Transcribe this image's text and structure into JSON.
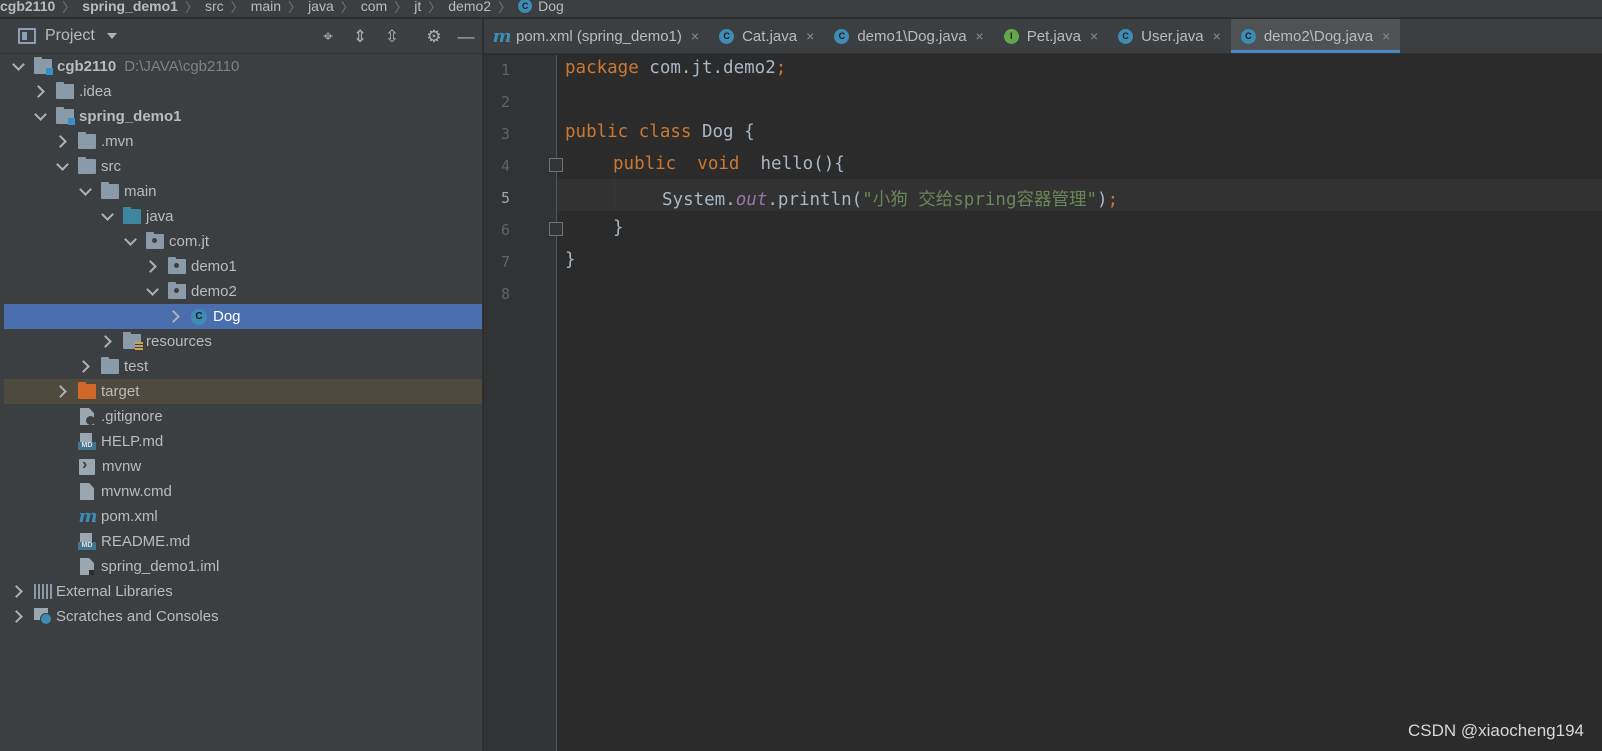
{
  "breadcrumb": {
    "items": [
      "cgb2110",
      "spring_demo1",
      "src",
      "main",
      "java",
      "com",
      "jt",
      "demo2"
    ],
    "last": "Dog",
    "last_icon": "C"
  },
  "project_panel": {
    "title": "Project",
    "icons": [
      "locate-icon",
      "expand-all-icon",
      "collapse-all-icon",
      "gear-icon",
      "minimize-icon"
    ],
    "tree": [
      {
        "label": "cgb2110",
        "hint": "D:\\JAVA\\cgb2110",
        "icon": "module-folder-icon"
      },
      {
        "label": ".idea",
        "icon": "folder-icon"
      },
      {
        "label": "spring_demo1",
        "icon": "module-folder-icon"
      },
      {
        "label": ".mvn",
        "icon": "folder-icon"
      },
      {
        "label": "src",
        "icon": "folder-icon"
      },
      {
        "label": "main",
        "icon": "folder-icon"
      },
      {
        "label": "java",
        "icon": "source-folder-icon"
      },
      {
        "label": "com.jt",
        "icon": "package-icon"
      },
      {
        "label": "demo1",
        "icon": "package-icon"
      },
      {
        "label": "demo2",
        "icon": "package-icon"
      },
      {
        "label": "Dog",
        "icon": "class-icon",
        "class_letter": "C"
      },
      {
        "label": "resources",
        "icon": "resources-folder-icon"
      },
      {
        "label": "test",
        "icon": "folder-icon"
      },
      {
        "label": "target",
        "icon": "excluded-folder-icon"
      },
      {
        "label": ".gitignore",
        "icon": "gitignore-file-icon"
      },
      {
        "label": "HELP.md",
        "icon": "markdown-file-icon"
      },
      {
        "label": "mvnw",
        "icon": "shell-file-icon"
      },
      {
        "label": "mvnw.cmd",
        "icon": "file-icon"
      },
      {
        "label": "pom.xml",
        "icon": "maven-icon"
      },
      {
        "label": "README.md",
        "icon": "markdown-file-icon"
      },
      {
        "label": "spring_demo1.iml",
        "icon": "iml-file-icon"
      },
      {
        "label": "External Libraries",
        "icon": "library-icon"
      },
      {
        "label": "Scratches and Consoles",
        "icon": "scratches-icon"
      }
    ]
  },
  "tabs": [
    {
      "label": "pom.xml (spring_demo1)",
      "icon": "m",
      "active": false
    },
    {
      "label": "Cat.java",
      "icon": "C",
      "active": false
    },
    {
      "label": "demo1\\Dog.java",
      "icon": "C",
      "active": false
    },
    {
      "label": "Pet.java",
      "icon": "I",
      "active": false
    },
    {
      "label": "User.java",
      "icon": "C",
      "active": false
    },
    {
      "label": "demo2\\Dog.java",
      "icon": "C",
      "active": true
    }
  ],
  "tab_close_glyph": "×",
  "editor": {
    "line_numbers": [
      "1",
      "2",
      "3",
      "4",
      "5",
      "6",
      "7",
      "8"
    ],
    "current_line": 5,
    "code": {
      "l1_kw": "package",
      "l1_rest": " com.jt.demo2",
      "l1_semi": ";",
      "l3_kw1": "public",
      "l3_kw2": " class",
      "l3_name": " Dog",
      "l3_brace": " {",
      "l4_kw1": "public",
      "l4_kw2": "  void",
      "l4_method": "  hello",
      "l4_rest": "(){",
      "l5_obj": "System.",
      "l5_field": "out",
      "l5_call": ".println(",
      "l5_str": "\"小狗 交给spring容器管理\"",
      "l5_close": ")",
      "l5_semi": ";",
      "l6_brace": "}",
      "l7_brace": "}"
    },
    "colors": {
      "keyword": "#cc7832",
      "string": "#6a8759",
      "field": "#9876aa",
      "text": "#a9b7c6"
    }
  },
  "watermark": "CSDN @xiaocheng194"
}
